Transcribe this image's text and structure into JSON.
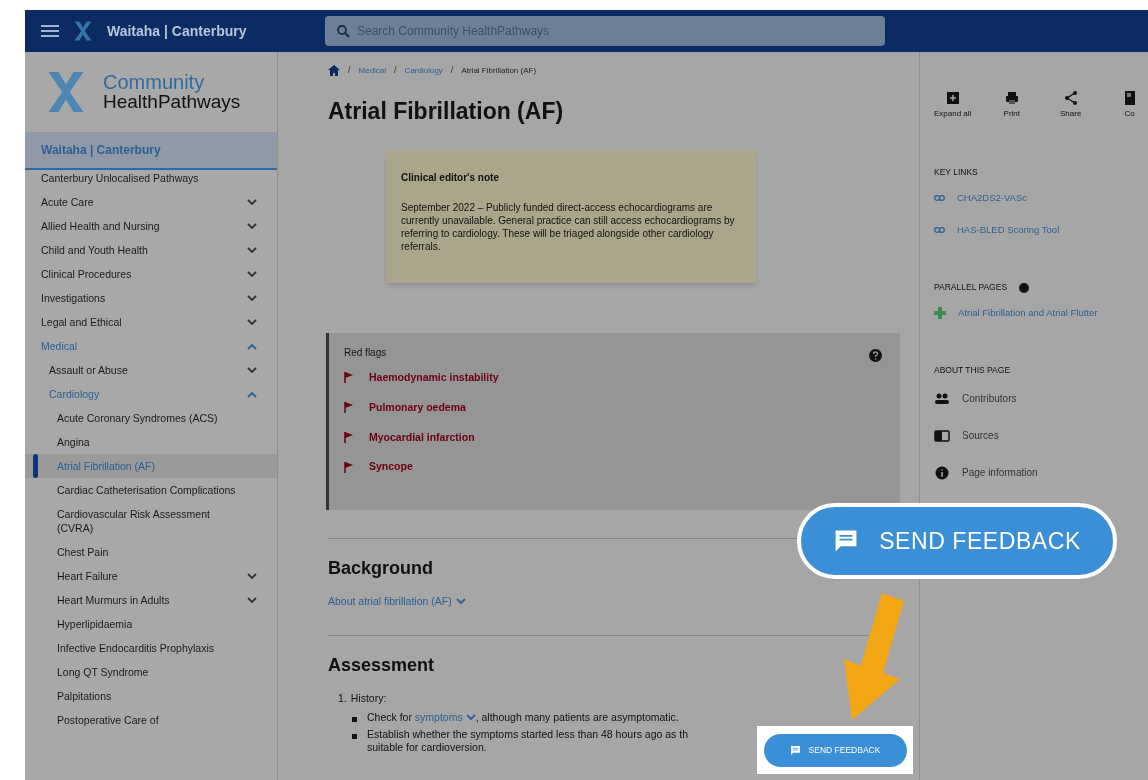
{
  "top_bar": {
    "region": "Waitaha | Canterbury",
    "search": {
      "placeholder": "Search Community HealthPathways"
    }
  },
  "sidebar": {
    "logo": {
      "line1": "Community",
      "line2": "HealthPathways"
    },
    "region_tab": "Waitaha | Canterbury",
    "items": [
      {
        "label": "Canterbury Unlocalised Pathways",
        "kind": "page",
        "selected": false
      },
      {
        "label": "Acute Care",
        "kind": "group",
        "expanded": false,
        "selected": false
      },
      {
        "label": "Allied Health and Nursing",
        "kind": "group",
        "expanded": false,
        "selected": false
      },
      {
        "label": "Child and Youth Health",
        "kind": "group",
        "expanded": false,
        "selected": false
      },
      {
        "label": "Clinical Procedures",
        "kind": "group",
        "expanded": false,
        "selected": false
      },
      {
        "label": "Investigations",
        "kind": "group",
        "expanded": false,
        "selected": false
      },
      {
        "label": "Legal and Ethical",
        "kind": "group",
        "expanded": false,
        "selected": false
      },
      {
        "label": "Medical",
        "kind": "group",
        "expanded": true,
        "selected": false,
        "children": [
          {
            "label": "Assault or Abuse",
            "kind": "group",
            "expanded": false,
            "selected": false
          },
          {
            "label": "Cardiology",
            "kind": "group",
            "expanded": true,
            "selected": false,
            "children": [
              {
                "label": "Acute Coronary Syndromes (ACS)",
                "kind": "page",
                "selected": false
              },
              {
                "label": "Angina",
                "kind": "page",
                "selected": false
              },
              {
                "label": "Atrial Fibrillation (AF)",
                "kind": "page",
                "selected": true
              },
              {
                "label": "Cardiac Catheterisation Complications",
                "kind": "page",
                "selected": false
              },
              {
                "label": "Cardiovascular Risk Assessment (CVRA)",
                "kind": "page",
                "selected": false
              },
              {
                "label": "Chest Pain",
                "kind": "page",
                "selected": false
              },
              {
                "label": "Heart Failure",
                "kind": "group",
                "expanded": false,
                "selected": false
              },
              {
                "label": "Heart Murmurs in Adults",
                "kind": "group",
                "expanded": false,
                "selected": false
              },
              {
                "label": "Hyperlipidaemia",
                "kind": "page",
                "selected": false
              },
              {
                "label": "Infective Endocarditis Prophylaxis",
                "kind": "page",
                "selected": false
              },
              {
                "label": "Long QT Syndrome",
                "kind": "page",
                "selected": false
              },
              {
                "label": "Palpitations",
                "kind": "page",
                "selected": false
              },
              {
                "label": "Postoperative Care of",
                "kind": "page",
                "selected": false
              }
            ]
          }
        ]
      }
    ]
  },
  "breadcrumb_separator": "/",
  "breadcrumb": [
    {
      "label": "Medical",
      "kind": "link"
    },
    {
      "label": "Cardiology",
      "kind": "link"
    },
    {
      "label": "Atrial Fibrillation (AF)",
      "kind": "current"
    }
  ],
  "title": "Atrial Fibrillation (AF)",
  "editor_note": {
    "heading": "Clinical editor's note",
    "text": "September 2022 – Publicly funded direct-access echocardiograms are currently unavailable. General practice can still access echocardiograms by referring to cardiology. These will be triaged alongside other cardiology referrals."
  },
  "red_flags": {
    "title": "Red flags",
    "items": [
      "Haemodynamic instability",
      "Pulmonary oedema",
      "Myocardial infarction",
      "Syncope"
    ]
  },
  "background": {
    "heading": "Background",
    "link": "About atrial fibrillation (AF)"
  },
  "assessment": {
    "heading": "Assessment",
    "steps": [
      {
        "number": "1.",
        "label": "History:",
        "bullets": [
          {
            "parts": [
              {
                "kind": "text",
                "text": "Check for "
              },
              {
                "kind": "link",
                "text": "symptoms"
              },
              {
                "kind": "text",
                "text": ", although many patients are asymptomatic."
              }
            ]
          },
          {
            "parts": [
              {
                "kind": "text",
                "text": "Establish whether the symptoms started less than 48 hours ago as th"
              }
            ],
            "continuation": "suitable for cardioversion."
          }
        ]
      }
    ]
  },
  "right_panel": {
    "tools": [
      {
        "label": "Expand all",
        "kind": "expand"
      },
      {
        "label": "Print",
        "kind": "print"
      },
      {
        "label": "Share",
        "kind": "share"
      },
      {
        "label": "Co",
        "kind": "copy"
      }
    ],
    "key_links": {
      "heading": "KEY LINKS",
      "links": [
        "CHA2DS2-VASc",
        "HAS-BLED Scoring Tool"
      ]
    },
    "parallel_pages": {
      "heading": "PARALLEL PAGES",
      "links": [
        "Atrial Fibrillation and Atrial Flutter"
      ]
    },
    "about": {
      "heading": "ABOUT THIS PAGE",
      "items": [
        {
          "label": "Contributors",
          "kind": "people"
        },
        {
          "label": "Sources",
          "kind": "sources"
        },
        {
          "label": "Page information",
          "kind": "info"
        }
      ]
    }
  },
  "feedback": {
    "callout_label": "SEND FEEDBACK",
    "button_label": "SEND FEEDBACK"
  }
}
